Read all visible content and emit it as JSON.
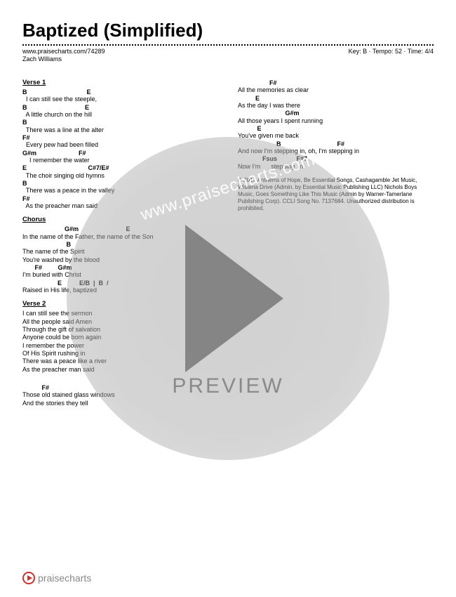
{
  "header": {
    "title": "Baptized (Simplified)",
    "url": "www.praisecharts.com/74289",
    "meta": "Key: B · Tempo: 52 · Time: 4/4",
    "artist": "Zach Williams"
  },
  "watermark": {
    "url": "www.praisecharts.com",
    "preview": "PREVIEW"
  },
  "footer": {
    "brand": "praisecharts"
  },
  "left": {
    "v1_label": "Verse 1",
    "v1": [
      {
        "c": "B                                  E",
        "l": "  I can still see the steeple,"
      },
      {
        "c": "B                                 E",
        "l": "  A little church on the hill"
      },
      {
        "c": "B",
        "l": "  There was a line at the alter"
      },
      {
        "c": "F#",
        "l": "  Every pew had been filled"
      },
      {
        "c": "G#m                        F#",
        "l": "    I remember the water"
      },
      {
        "c": "E                                   C#7/E#",
        "l": "  The choir singing old hymns"
      },
      {
        "c": "B",
        "l": "  There was a peace in the valley"
      },
      {
        "c": "F#",
        "l": "  As the preacher man said"
      }
    ],
    "ch_label": "Chorus",
    "ch": [
      {
        "c": "                        G#m                           E",
        "l": "In the name of the Father, the name of the Son"
      },
      {
        "c": "                         B",
        "l": "The name of the Spirit"
      },
      {
        "c": "",
        "l": "You're washed by the blood"
      },
      {
        "c": "       F#         G#m",
        "l": "I'm buried with Christ"
      },
      {
        "c": "                    E          E/B  |  B  /",
        "l": "Raised in His life, baptized"
      }
    ],
    "v2_label": "Verse 2",
    "v2": [
      {
        "c": "",
        "l": "I can still see the sermon"
      },
      {
        "c": "",
        "l": "All the people said Amen"
      },
      {
        "c": "",
        "l": "Through the gift of salvation"
      },
      {
        "c": "",
        "l": "Anyone could be born again"
      },
      {
        "c": "",
        "l": "I remember the power"
      },
      {
        "c": "",
        "l": "Of His Spirit rushing in"
      },
      {
        "c": "",
        "l": "There was a peace like a river"
      },
      {
        "c": "",
        "l": "As the preacher man said"
      }
    ],
    "br": [
      {
        "c": "           F#",
        "l": "Those old stained glass windows"
      },
      {
        "c": "",
        "l": "And the stories they tell"
      }
    ]
  },
  "right": {
    "lines": [
      {
        "c": "                  F#",
        "l": "All the memories as clear"
      },
      {
        "c": "          E",
        "l": "As the day I was there"
      },
      {
        "c": "                           G#m",
        "l": "All those years I spent running"
      },
      {
        "c": "           E",
        "l": "You've given me back"
      },
      {
        "c": "                      B                                F#",
        "l": "And now I'm stepping in, oh, I'm stepping in"
      },
      {
        "c": "              Fsus           F#7",
        "l": "Now I'm      stepping  in"
      }
    ],
    "copyright": "© 2019 Anthems of Hope, Be Essential Songs, Cashagamble Jet Music, Wisteria Drive (Admin. by Essential Music Publishing LLC) Nichols Boys Music, Goes Something Like This Music (Admin by Warner-Tamerlane Publishing Corp). CCLI Song No. 7137684. Unauthorized distribution is prohibited."
  }
}
